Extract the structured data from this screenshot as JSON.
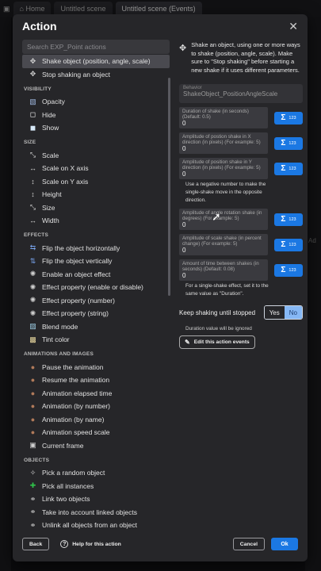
{
  "tabs": [
    "Home",
    "Untitled scene",
    "Untitled scene (Events)"
  ],
  "background_side_text": "Ad",
  "dialog": {
    "title": "Action",
    "search_placeholder": "Search EXP_Point actions",
    "top_items": [
      {
        "label": "Shake object (position, angle, scale)",
        "icon": "move-icon",
        "selected": true
      },
      {
        "label": "Stop shaking an object",
        "icon": "move-icon",
        "selected": false
      }
    ],
    "sections": [
      {
        "title": "VISIBILITY",
        "items": [
          {
            "label": "Opacity",
            "icon": "opacity-icon"
          },
          {
            "label": "Hide",
            "icon": "hide-icon"
          },
          {
            "label": "Show",
            "icon": "show-icon"
          }
        ]
      },
      {
        "title": "SIZE",
        "items": [
          {
            "label": "Scale",
            "icon": "scale-icon"
          },
          {
            "label": "Scale on X axis",
            "icon": "scale-x-icon"
          },
          {
            "label": "Scale on Y axis",
            "icon": "scale-y-icon"
          },
          {
            "label": "Height",
            "icon": "height-icon"
          },
          {
            "label": "Size",
            "icon": "size-icon"
          },
          {
            "label": "Width",
            "icon": "width-icon"
          }
        ]
      },
      {
        "title": "EFFECTS",
        "items": [
          {
            "label": "Flip the object horizontally",
            "icon": "flip-horizontal-icon"
          },
          {
            "label": "Flip the object vertically",
            "icon": "flip-vertical-icon"
          },
          {
            "label": "Enable an object effect",
            "icon": "effect-icon"
          },
          {
            "label": "Effect property (enable or disable)",
            "icon": "effect-icon"
          },
          {
            "label": "Effect property (number)",
            "icon": "effect-icon"
          },
          {
            "label": "Effect property (string)",
            "icon": "effect-icon"
          },
          {
            "label": "Blend mode",
            "icon": "blend-mode-icon"
          },
          {
            "label": "Tint color",
            "icon": "tint-color-icon"
          }
        ]
      },
      {
        "title": "ANIMATIONS AND IMAGES",
        "items": [
          {
            "label": "Pause the animation",
            "icon": "animation-icon"
          },
          {
            "label": "Resume the animation",
            "icon": "animation-icon"
          },
          {
            "label": "Animation elapsed time",
            "icon": "animation-icon"
          },
          {
            "label": "Animation (by number)",
            "icon": "animation-icon"
          },
          {
            "label": "Animation (by name)",
            "icon": "animation-icon"
          },
          {
            "label": "Animation speed scale",
            "icon": "animation-icon"
          },
          {
            "label": "Current frame",
            "icon": "frame-icon"
          }
        ]
      },
      {
        "title": "OBJECTS",
        "items": [
          {
            "label": "Pick a random object",
            "icon": "random-icon"
          },
          {
            "label": "Pick all instances",
            "icon": "pick-all-icon"
          },
          {
            "label": "Link two objects",
            "icon": "link-icon"
          },
          {
            "label": "Take into account linked objects",
            "icon": "link-icon"
          },
          {
            "label": "Unlink all objects from an object",
            "icon": "link-icon"
          }
        ]
      }
    ],
    "description": "Shake an object, using one or more ways to shake (position, angle, scale). Make sure to \"Stop shaking\" before starting a new shake if it uses different parameters.",
    "behavior": {
      "label": "Behavior",
      "value": "ShakeObject_PositionAngleScale"
    },
    "expr_number_label": "123",
    "params": [
      {
        "label": "Duration of shake (in seconds) (Default: 0.5)",
        "value": "0",
        "helper": ""
      },
      {
        "label": "Amplitude of postion shake in X direction (in pixels) (For example: 5)",
        "value": "0",
        "helper": ""
      },
      {
        "label": "Amplitude of position shake in Y direction (in pixels) (For example: 5)",
        "value": "0",
        "helper": "Use a negative number to make the single-shake move in the opposite direction."
      },
      {
        "label": "Amplitude of angle rotation shake (in degrees) (For example: 5)",
        "value": "0",
        "helper": ""
      },
      {
        "label": "Amplitude of scale shake (in percent change) (For example: 5)",
        "value": "0",
        "helper": ""
      },
      {
        "label": "Amount of time between shakes (in seconds) (Default: 0.08)",
        "value": "0",
        "helper": "For a single-shake effect, set it to the same value as \"Duration\"."
      }
    ],
    "keep_shaking": {
      "label": "Keep shaking until stopped",
      "yes": "Yes",
      "no": "No",
      "selected": "No"
    },
    "ignored_note": "Duration value will be ignored",
    "edit_events_label": "Edit this action events",
    "footer": {
      "back": "Back",
      "help": "Help for this action",
      "cancel": "Cancel",
      "ok": "Ok"
    }
  },
  "colors": {
    "accent": "#1b78e3",
    "dialog_bg": "#262629",
    "selected_row": "#4a4a50"
  }
}
